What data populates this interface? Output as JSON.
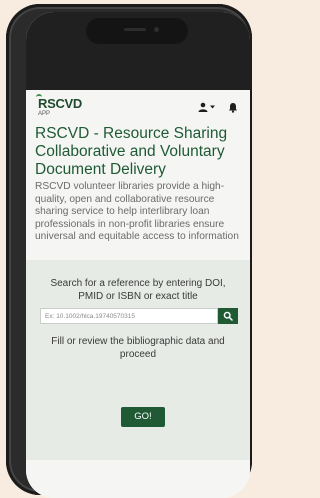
{
  "app": {
    "logo_text": "RSCVD",
    "logo_subtext": "APP"
  },
  "header": {
    "icons": [
      "user-icon",
      "chevron-down-icon",
      "bell-icon"
    ]
  },
  "main": {
    "title": "RSCVD - Resource Sharing Collaborative and Voluntary Document Delivery",
    "description": "RSCVD volunteer libraries provide a high-quality, open and collaborative resource sharing service to help interlibrary loan professionals in non-profit libraries ensure universal and equitable access to information"
  },
  "search": {
    "prompt": "Search for a reference by entering DOI, PMID or ISBN or exact title",
    "placeholder": "Ex: 10.1002/hlca.19740570315",
    "fill_text": "Fill or review the bibliographic data and proceed",
    "go_label": "GO!"
  },
  "colors": {
    "brand_green": "#1f5a34",
    "page_background": "#f7ecdf",
    "panel_background": "#e7ebe6"
  }
}
